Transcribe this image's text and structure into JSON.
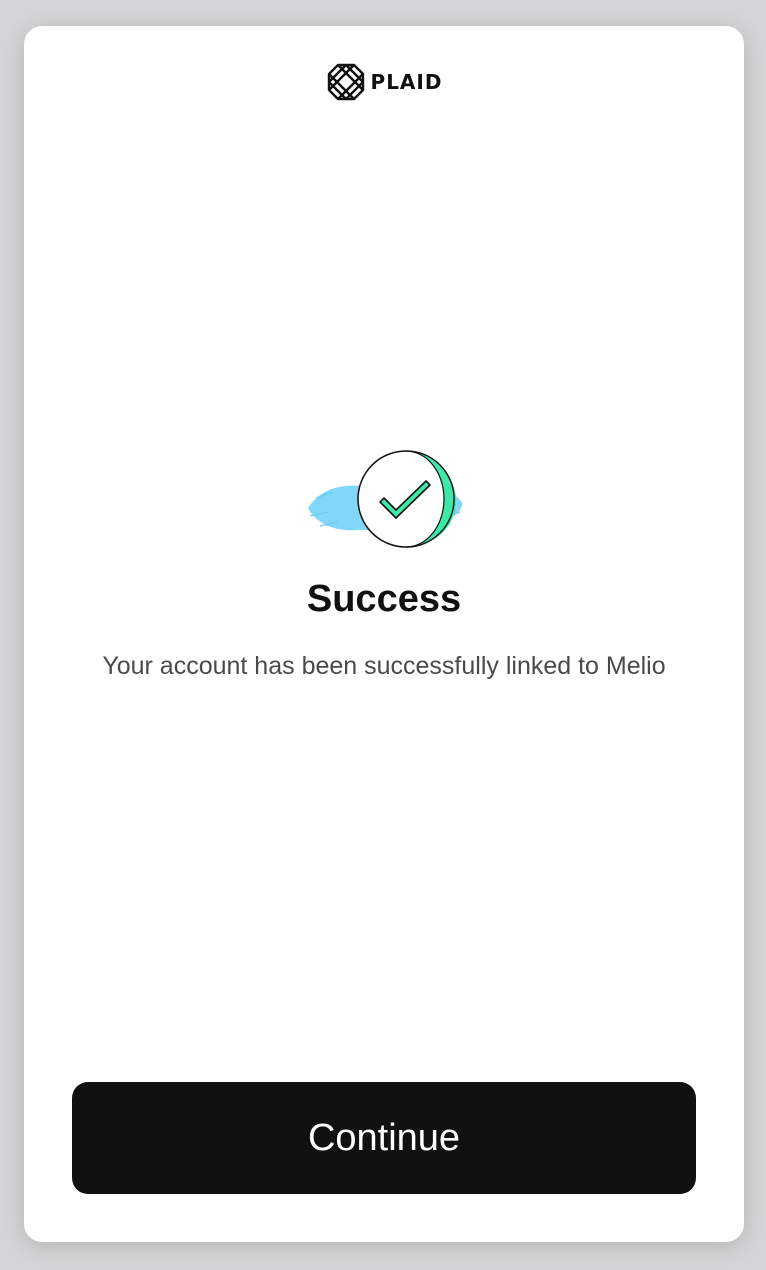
{
  "brand": {
    "name": "PLAID",
    "logo_icon": "plaid-logo-icon"
  },
  "status": {
    "icon": "success-check-icon",
    "title": "Success",
    "message": "Your account has been successfully linked to Melio"
  },
  "actions": {
    "continue_label": "Continue"
  },
  "colors": {
    "background": "#d4d5d6",
    "card": "#ffffff",
    "button": "#111111",
    "button_text": "#ffffff",
    "check_green": "#3ee8a8",
    "brush_blue": "#6ccff6"
  }
}
